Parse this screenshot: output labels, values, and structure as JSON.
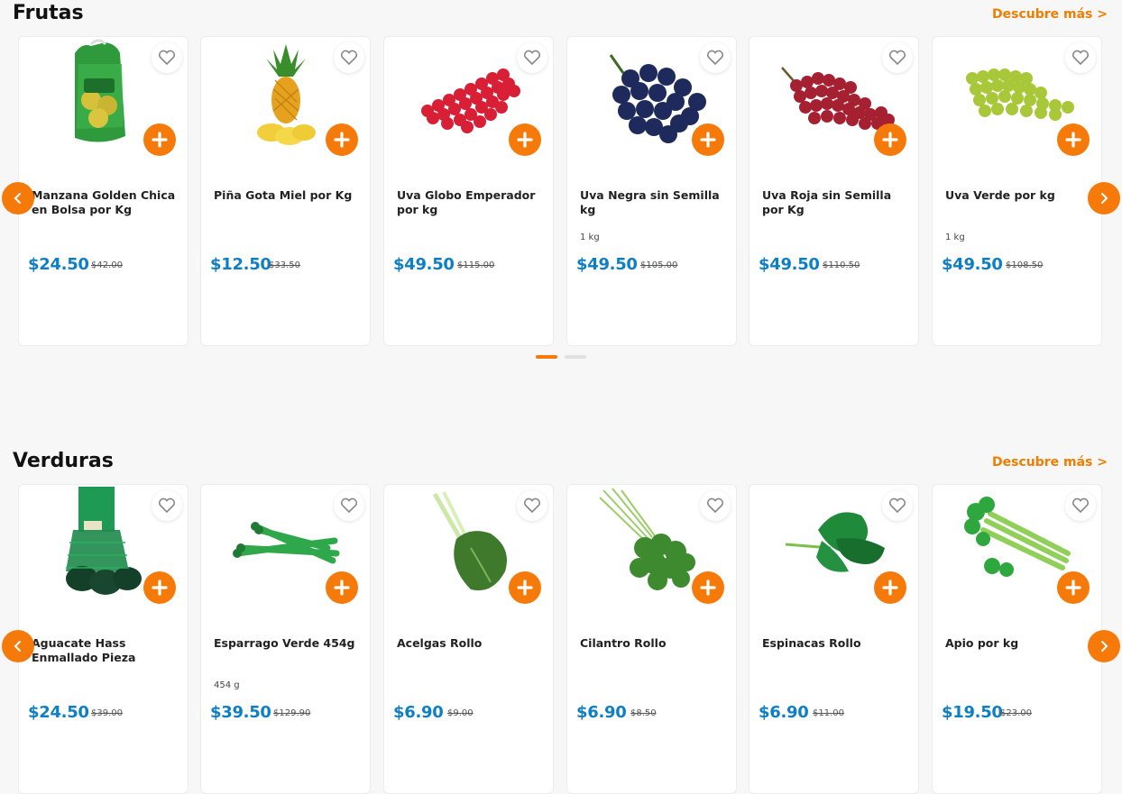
{
  "colors": {
    "accent": "#f57a0a",
    "price": "#0e7fc4",
    "background": "#f7f7f7"
  },
  "frutas": {
    "title": "Frutas",
    "see_more": "Descubre más >",
    "products": [
      {
        "name": "Manzana Golden Chica en Bolsa por Kg",
        "weight": "",
        "price": "$24.50",
        "old_price": "$42.00",
        "icon": "apple-bag-image"
      },
      {
        "name": "Piña Gota Miel por Kg",
        "weight": "",
        "price": "$12.50",
        "old_price": "$33.50",
        "icon": "pineapple-image"
      },
      {
        "name": "Uva Globo Emperador por kg",
        "weight": "",
        "price": "$49.50",
        "old_price": "$115.00",
        "icon": "red-grapes-image"
      },
      {
        "name": "Uva Negra sin Semilla kg",
        "weight": "1 kg",
        "price": "$49.50",
        "old_price": "$105.00",
        "icon": "black-grapes-image"
      },
      {
        "name": "Uva Roja sin Semilla por Kg",
        "weight": "",
        "price": "$49.50",
        "old_price": "$110.50",
        "icon": "red-seedless-grapes-image"
      },
      {
        "name": "Uva Verde por kg",
        "weight": "1 kg",
        "price": "$49.50",
        "old_price": "$108.50",
        "icon": "green-grapes-image"
      }
    ]
  },
  "verduras": {
    "title": "Verduras",
    "see_more": "Descubre más >",
    "products": [
      {
        "name": "Aguacate Hass Enmallado Pieza",
        "weight": "",
        "price": "$24.50",
        "old_price": "$39.00",
        "icon": "avocado-mesh-image"
      },
      {
        "name": "Esparrago Verde 454g",
        "weight": "454 g",
        "price": "$39.50",
        "old_price": "$129.90",
        "icon": "asparagus-image"
      },
      {
        "name": "Acelgas Rollo",
        "weight": "",
        "price": "$6.90",
        "old_price": "$9.00",
        "icon": "chard-image"
      },
      {
        "name": "Cilantro Rollo",
        "weight": "",
        "price": "$6.90",
        "old_price": "$8.50",
        "icon": "cilantro-image"
      },
      {
        "name": "Espinacas Rollo",
        "weight": "",
        "price": "$6.90",
        "old_price": "$11.00",
        "icon": "spinach-image"
      },
      {
        "name": "Apio por kg",
        "weight": "",
        "price": "$19.50",
        "old_price": "$23.00",
        "icon": "celery-image"
      }
    ]
  }
}
